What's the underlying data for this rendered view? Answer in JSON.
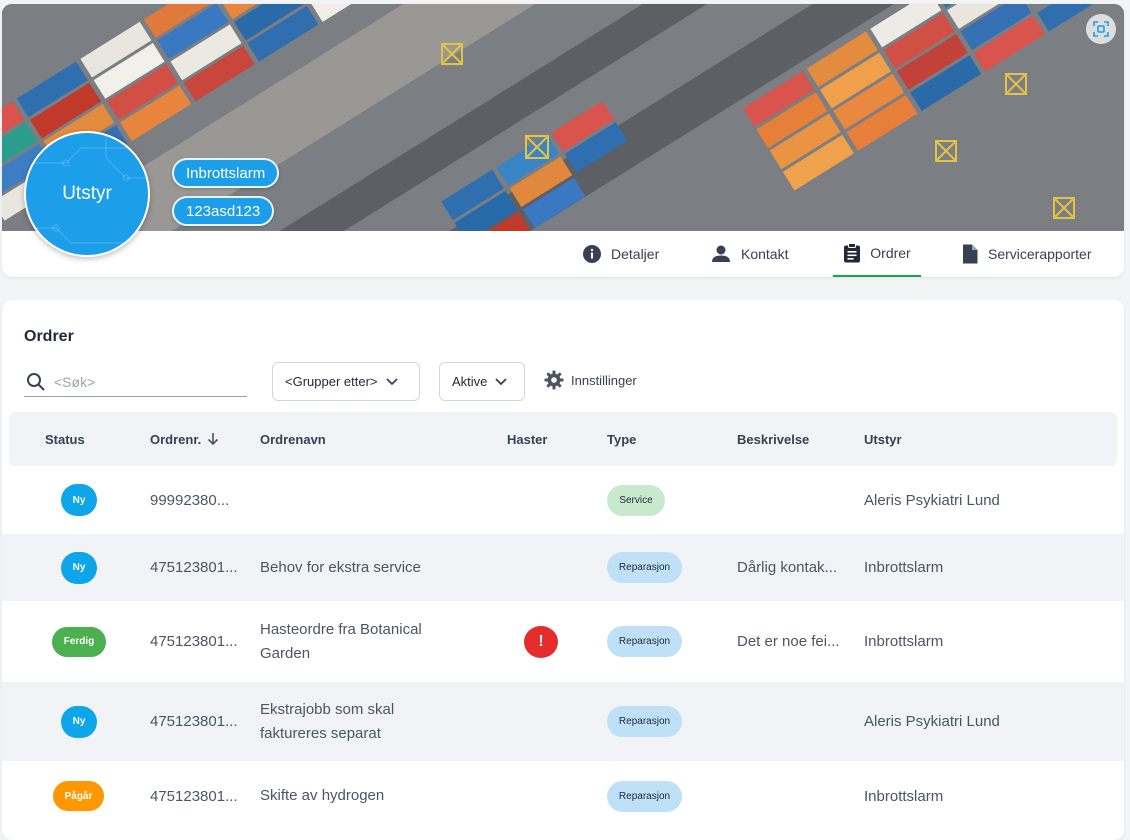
{
  "header": {
    "avatar_label": "Utstyr",
    "tags": [
      "Inbrottslarm",
      "123asd123"
    ],
    "tabs": [
      {
        "label": "Detaljer",
        "icon": "info-icon"
      },
      {
        "label": "Kontakt",
        "icon": "person-icon"
      },
      {
        "label": "Ordrer",
        "icon": "clipboard-icon",
        "active": true
      },
      {
        "label": "Servicerapporter",
        "icon": "document-icon"
      }
    ]
  },
  "orders": {
    "title": "Ordrer",
    "search_placeholder": "<Søk>",
    "group_by_label": "<Grupper etter>",
    "filter_label": "Aktive",
    "settings_label": "Innstillinger",
    "columns": [
      "Status",
      "Ordrenr.",
      "Ordrenavn",
      "Haster",
      "Type",
      "Beskrivelse",
      "Utstyr"
    ],
    "rows": [
      {
        "status": "Ny",
        "number": "99992380...",
        "name": "",
        "urgent": false,
        "type": "Service",
        "description": "",
        "equipment": "Aleris Psykiatri Lund"
      },
      {
        "status": "Ny",
        "number": "475123801...",
        "name": "Behov for ekstra service",
        "urgent": false,
        "type": "Reparasjon",
        "description": "Dårlig kontak...",
        "equipment": "Inbrottslarm"
      },
      {
        "status": "Ferdig",
        "number": "475123801...",
        "name": "Hasteordre fra Botanical Garden",
        "urgent": true,
        "urgent_symbol": "!",
        "type": "Reparasjon",
        "description": "Det er noe fei...",
        "equipment": "Inbrottslarm"
      },
      {
        "status": "Ny",
        "number": "475123801...",
        "name": "Ekstrajobb som skal faktureres separat",
        "urgent": false,
        "type": "Reparasjon",
        "description": "",
        "equipment": "Aleris Psykiatri Lund"
      },
      {
        "status": "Pågår",
        "number": "475123801...",
        "name": "Skifte av hydrogen",
        "urgent": false,
        "type": "Reparasjon",
        "description": "",
        "equipment": "Inbrottslarm"
      }
    ]
  },
  "colors": {
    "accent_blue": "#1c9ee8",
    "status_ny": "#0ea5e9",
    "status_ferdig": "#4caf50",
    "status_pagar": "#ff9800",
    "urgent_red": "#e52b2b",
    "active_tab_underline": "#16a34a"
  }
}
